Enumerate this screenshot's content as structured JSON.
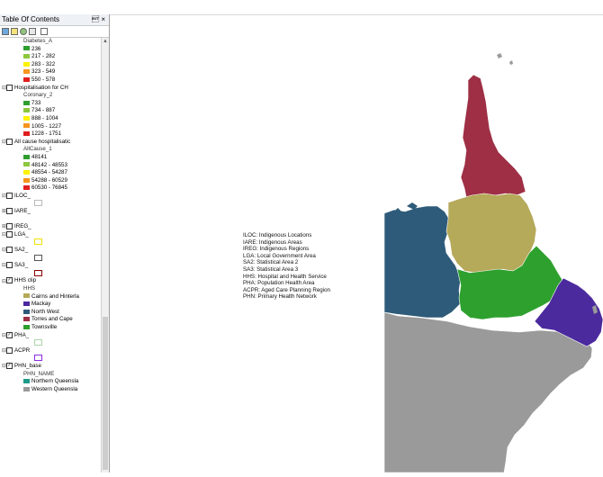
{
  "toc": {
    "title": "Table Of Contents",
    "pin": "\u0004 ×"
  },
  "layers": [
    {
      "type": "field",
      "label": "Diabetes_A"
    },
    {
      "type": "class",
      "label": "236",
      "color": "#2f9e2f"
    },
    {
      "type": "class",
      "label": "217 - 282",
      "color": "#8cc63f"
    },
    {
      "type": "class",
      "label": "283 - 322",
      "color": "#fff200"
    },
    {
      "type": "class",
      "label": "323 - 549",
      "color": "#f7941d"
    },
    {
      "type": "class",
      "label": "550 - 578",
      "color": "#e01e1e"
    },
    {
      "type": "layer",
      "label": "Hospitalisation for CH",
      "checked": false,
      "expanded": true
    },
    {
      "type": "field",
      "label": "Coronary_2"
    },
    {
      "type": "class",
      "label": "733",
      "color": "#2f9e2f"
    },
    {
      "type": "class",
      "label": "734 - 887",
      "color": "#8cc63f"
    },
    {
      "type": "class",
      "label": "888 - 1004",
      "color": "#fff200"
    },
    {
      "type": "class",
      "label": "1005 - 1227",
      "color": "#f7941d"
    },
    {
      "type": "class",
      "label": "1228 - 1751",
      "color": "#e01e1e"
    },
    {
      "type": "layer",
      "label": "All cause hospitalisatic",
      "checked": false,
      "expanded": true
    },
    {
      "type": "field",
      "label": "AllCause_1"
    },
    {
      "type": "class",
      "label": "48141",
      "color": "#2f9e2f"
    },
    {
      "type": "class",
      "label": "48142 - 48553",
      "color": "#8cc63f"
    },
    {
      "type": "class",
      "label": "48554 - 54287",
      "color": "#fff200"
    },
    {
      "type": "class",
      "label": "54288 - 60529",
      "color": "#f7941d"
    },
    {
      "type": "class",
      "label": "60530 - 76845",
      "color": "#e01e1e"
    },
    {
      "type": "layer",
      "label": "ILOC_",
      "checked": false,
      "expanded": true
    },
    {
      "type": "hollow",
      "color": "#bbbbbb"
    },
    {
      "type": "layer",
      "label": "IARE_",
      "checked": false,
      "expanded": false
    },
    {
      "type": "blank"
    },
    {
      "type": "layer",
      "label": "IREG_",
      "checked": false,
      "expanded": false
    },
    {
      "type": "layer",
      "label": "LGA_",
      "checked": false,
      "expanded": true
    },
    {
      "type": "hollow",
      "color": "#f0e000"
    },
    {
      "type": "layer",
      "label": "SA2_",
      "checked": false,
      "expanded": true
    },
    {
      "type": "hollow",
      "color": "#555555"
    },
    {
      "type": "layer",
      "label": "SA3_",
      "checked": false,
      "expanded": true
    },
    {
      "type": "hollow",
      "color": "#8b0000"
    },
    {
      "type": "layer",
      "label": "HHS clip",
      "checked": true,
      "expanded": true
    },
    {
      "type": "field",
      "label": "HHS"
    },
    {
      "type": "class",
      "label": "Cairns and Hinterla",
      "color": "#b5a95a"
    },
    {
      "type": "class",
      "label": "Mackay",
      "color": "#4b2a9e"
    },
    {
      "type": "class",
      "label": "North West",
      "color": "#2e5b7a"
    },
    {
      "type": "class",
      "label": "Torres and Cape",
      "color": "#9e2f45"
    },
    {
      "type": "class",
      "label": "Townsville",
      "color": "#2ea02e"
    },
    {
      "type": "layer",
      "label": "PHA_",
      "checked": true,
      "expanded": true
    },
    {
      "type": "hollow",
      "color": "#aad4aa"
    },
    {
      "type": "layer",
      "label": "ACPR",
      "checked": false,
      "expanded": true
    },
    {
      "type": "hollow",
      "color": "#8a2be2"
    },
    {
      "type": "layer",
      "label": "PHN_base",
      "checked": true,
      "expanded": true
    },
    {
      "type": "field",
      "label": "PHN_NAME"
    },
    {
      "type": "class",
      "label": "Northern Queensla",
      "color": "#1e9a8a"
    },
    {
      "type": "class",
      "label": "Western Queensla",
      "color": "#9a9a9a"
    }
  ],
  "map_legend": [
    "ILOC: Indigenous Locations",
    "IARE: Indigenous Areas",
    "IREG: Indigenous Regions",
    "LGA: Local Government Area",
    "SA2: Statistical Area 2",
    "SA3: Statistical Area 3",
    "HHS: Hospital and Health Service",
    "PHA: Population Health Area",
    "ACPR: Aged Care Planning Region",
    "PHN: Primary Health Network"
  ],
  "region_colors": {
    "torres_and_cape": "#9e2f45",
    "cairns_and_hinterland": "#b5a95a",
    "north_west": "#2e5b7a",
    "townsville": "#2ea02e",
    "mackay": "#4b2a9e",
    "western_queensland": "#9a9a9a"
  }
}
